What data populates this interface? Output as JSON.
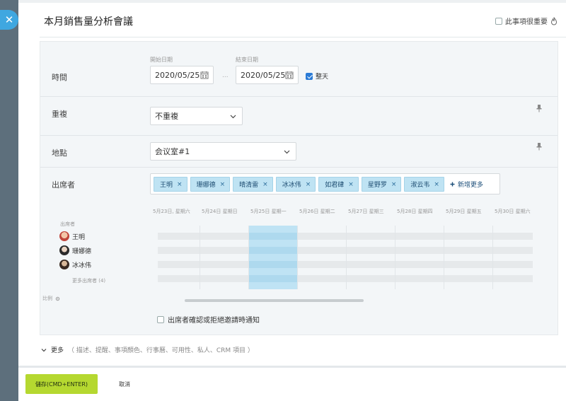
{
  "title": "本月銷售量分析會議",
  "important_label": "此事項很重要",
  "time": {
    "label": "時間",
    "start_label": "開始日期",
    "start_value": "2020/05/25",
    "separator": "...",
    "end_label": "結束日期",
    "end_value": "2020/05/25",
    "allday_label": "整天"
  },
  "repeat": {
    "label": "重複",
    "value": "不重複"
  },
  "location": {
    "label": "地點",
    "value": "会议室#1"
  },
  "attendees": {
    "label": "出席者",
    "chips": [
      "王明",
      "珊娜德",
      "晴清雷",
      "冰冰伟",
      "如君硉",
      "星野罗",
      "淑云韦"
    ],
    "chip_remove": "×",
    "add_more": "新增更多"
  },
  "schedule": {
    "dates": [
      "5月23日, 星期六",
      "5月24日 星期日",
      "5月25日 星期一",
      "5月26日 星期二",
      "5月27日 星期三",
      "5月28日 星期四",
      "5月29日 星期五",
      "5月30日 星期六"
    ],
    "attendees_header": "出席者",
    "people": [
      "王明",
      "珊娜德",
      "冰冰伟"
    ],
    "more_attendees": "更多出席者 (4)",
    "scale_label": "比例"
  },
  "notify_label": "出席者確認或拒絕邀請時通知",
  "more": {
    "label": "更多",
    "details": "（ 描述、提醒、事項顏色、行事曆、可用性、私人、CRM 項目 ）"
  },
  "footer": {
    "save_label": "儲存(CMD+ENTER)",
    "cancel_label": "取消"
  },
  "colors": {
    "accent_blue": "#3fa7e0",
    "save_green": "#b5d830",
    "chip_bg": "#bfe3f3",
    "check_blue": "#2b7bd6"
  },
  "icons": {
    "close": "close-icon",
    "calendar": "calendar-icon",
    "pin": "pin-icon",
    "fire": "fire-icon",
    "chevron": "chevron-down-icon",
    "plus": "plus-icon",
    "gear": "gear-icon"
  }
}
